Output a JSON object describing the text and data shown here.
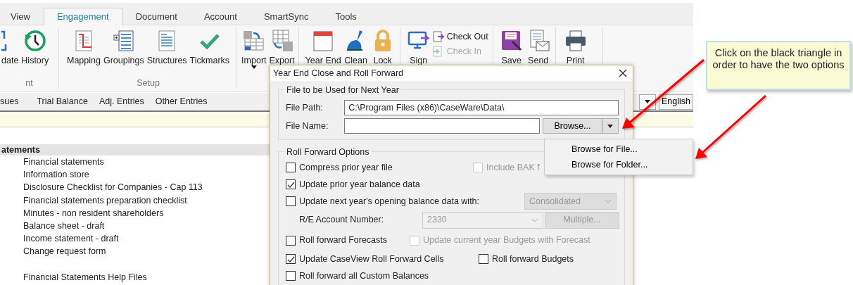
{
  "tabs": [
    {
      "label": "View",
      "selected": false
    },
    {
      "label": "Engagement",
      "selected": true
    },
    {
      "label": "Document",
      "selected": false
    },
    {
      "label": "Account",
      "selected": false
    },
    {
      "label": "SmartSync",
      "selected": false
    },
    {
      "label": "Tools",
      "selected": false
    }
  ],
  "ribbon": {
    "groups": [
      {
        "label": "nt",
        "buttons": [
          {
            "kind": "large",
            "label": "date"
          },
          {
            "kind": "large",
            "label": "History"
          }
        ]
      },
      {
        "label": "Setup",
        "buttons": [
          {
            "kind": "large",
            "label": "Mapping"
          },
          {
            "kind": "large",
            "label": "Groupings"
          },
          {
            "kind": "large",
            "label": "Structures"
          },
          {
            "kind": "large",
            "label": "Tickmarks"
          }
        ]
      },
      {
        "buttons": [
          {
            "kind": "large",
            "label": "Import",
            "dropdown": true
          },
          {
            "kind": "large",
            "label": "Export"
          }
        ]
      },
      {
        "buttons": [
          {
            "kind": "large",
            "label": "Year End"
          },
          {
            "kind": "large",
            "label": "Clean"
          },
          {
            "kind": "large",
            "label": "Lock"
          }
        ]
      },
      {
        "buttons": [
          {
            "kind": "large",
            "label": "Sign"
          },
          {
            "kind": "small",
            "label": "Check Out",
            "disabled": false
          },
          {
            "kind": "small",
            "label": "Check In",
            "disabled": true
          }
        ]
      },
      {
        "buttons": [
          {
            "kind": "large",
            "label": "Save"
          },
          {
            "kind": "large",
            "label": "Send"
          }
        ]
      },
      {
        "buttons": [
          {
            "kind": "large",
            "label": "Print"
          }
        ]
      }
    ]
  },
  "toolbar": {
    "items": [
      "sues",
      "Trial Balance",
      "Adj. Entries",
      "Other Entries"
    ],
    "language": "English"
  },
  "documents": {
    "header": "atements",
    "items": [
      "Financial statements",
      "Information store",
      "Disclosure Checklist for Companies - Cap 113",
      "Financial statements preparation checklist",
      "Minutes - non resident shareholders",
      "Balance sheet - draft",
      "Income statement - draft",
      "Change request form"
    ],
    "help_item": "Financial Statements Help Files"
  },
  "dialog": {
    "title": "Year End Close and Roll Forward",
    "file_group": {
      "legend": "File to be Used for Next Year",
      "path_label": "File Path:",
      "path_value": "C:\\Program Files (x86)\\CaseWare\\Data\\",
      "name_label": "File Name:",
      "browse_label": "Browse..."
    },
    "browse_menu": [
      "Browse for File...",
      "Browse for Folder..."
    ],
    "options": {
      "legend": "Roll Forward Options",
      "rows": [
        [
          {
            "kind": "checkbox",
            "label": "Compress prior year file",
            "checked": false,
            "disabled": false
          },
          {
            "kind": "checkbox",
            "label": "Include BAK f",
            "checked": false,
            "disabled": true
          }
        ],
        [
          {
            "kind": "checkbox",
            "label": "Update prior year balance data",
            "checked": true,
            "disabled": false
          }
        ],
        [
          {
            "kind": "checkbox",
            "label": "Update next year's opening balance data with:",
            "checked": false,
            "disabled": false
          },
          {
            "kind": "select",
            "value": "Consolidated",
            "disabled": true
          }
        ],
        [
          {
            "kind": "label",
            "label": "R/E Account Number:"
          },
          {
            "kind": "combo",
            "value": "2330",
            "disabled": true
          },
          {
            "kind": "button",
            "label": "Multiple...",
            "disabled": true
          }
        ],
        [
          {
            "kind": "checkbox",
            "label": "Roll forward Forecasts",
            "checked": false,
            "disabled": false
          },
          {
            "kind": "checkbox",
            "label": "Update current year Budgets with Forecast",
            "checked": false,
            "disabled": true
          }
        ],
        [
          {
            "kind": "checkbox",
            "label": "Update CaseView Roll Forward Cells",
            "checked": true,
            "disabled": false
          },
          {
            "kind": "checkbox",
            "label": "Roll forward Budgets",
            "checked": false,
            "disabled": false
          }
        ],
        [
          {
            "kind": "checkbox",
            "label": "Roll forward all Custom Balances",
            "checked": false,
            "disabled": false
          }
        ]
      ]
    }
  },
  "callout": {
    "text": "Click on the black triangle in order to have the two options"
  }
}
